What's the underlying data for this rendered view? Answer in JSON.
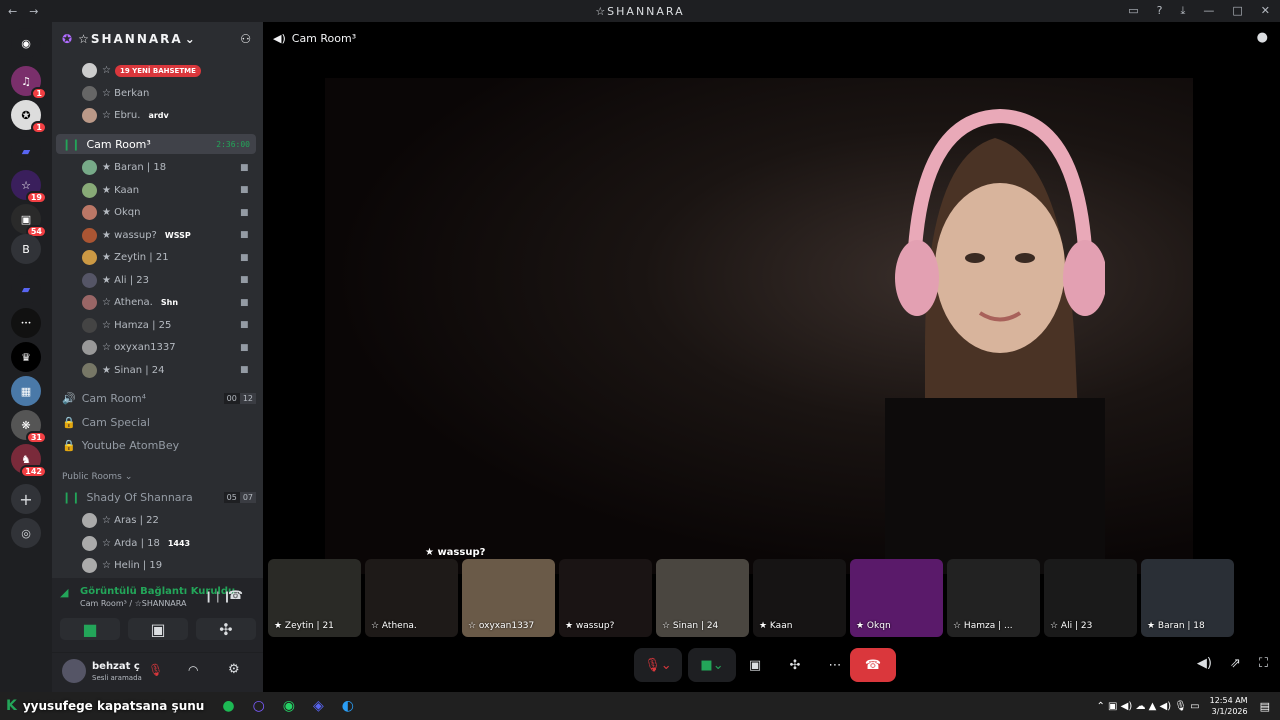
{
  "window": {
    "title": "☆SHANNARA"
  },
  "server": {
    "name": "☆SHANNARA"
  },
  "top_members": [
    {
      "name": "☆",
      "mention": "19 YENİ BAHSETME"
    },
    {
      "name": "☆ Berkan"
    },
    {
      "name": "☆ Ebru.",
      "tag": "ardv"
    }
  ],
  "active_channel": {
    "name": "Cam Room³",
    "timer": "2:36:00"
  },
  "voice_members": [
    {
      "name": "★ Baran | 18"
    },
    {
      "name": "★ Kaan"
    },
    {
      "name": "★ Okqn"
    },
    {
      "name": "★ wassup?",
      "tag": "WSSP"
    },
    {
      "name": "★ Zeytin | 21"
    },
    {
      "name": "★ Ali | 23"
    },
    {
      "name": "☆ Athena.",
      "tag": "Shn"
    },
    {
      "name": "☆ Hamza | 25"
    },
    {
      "name": "☆ oxyxan1337"
    },
    {
      "name": "★ Sinan | 24"
    }
  ],
  "other_channels": [
    {
      "name": "Cam Room⁴",
      "c1": "00",
      "c2": "12"
    },
    {
      "name": "Cam Special"
    },
    {
      "name": "Youtube AtomBey"
    }
  ],
  "category": "Public Rooms",
  "shady": {
    "name": "Shady Of Shannara",
    "c1": "05",
    "c2": "07"
  },
  "shady_members": [
    {
      "name": "☆ Aras | 22"
    },
    {
      "name": "☆ Arda | 18",
      "tag": "1443"
    },
    {
      "name": "☆ Helin | 19"
    }
  ],
  "voice_panel": {
    "status": "Görüntülü Bağlantı Kuruldu",
    "sub": "Cam Room³ / ☆SHANNARA"
  },
  "user": {
    "name": "behzat ç",
    "status": "Sesli aramada"
  },
  "guild_badges": [
    "1",
    "1",
    "19",
    "54",
    "31",
    "142"
  ],
  "stage": {
    "channel": "Cam Room³",
    "speaker": "★ wassup?"
  },
  "tiles": [
    "★ Zeytin | 21",
    "☆ Athena.",
    "☆ oxyxan1337",
    "★ wassup?",
    "☆ Sinan | 24",
    "★ Kaan",
    "★ Okqn",
    "☆ Hamza | ...",
    "☆ Ali | 23",
    "★ Baran | 18"
  ],
  "taskbar": {
    "overlay_text": "yyusufege  kapatsana şunu",
    "time": "12:54 AM",
    "date": "3/1/2026"
  },
  "colors": {
    "accent": "#23a559",
    "danger": "#da373c",
    "mention": "#f23f43"
  }
}
